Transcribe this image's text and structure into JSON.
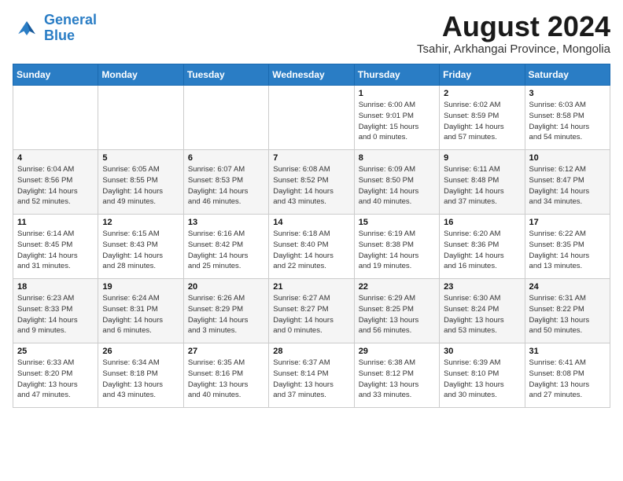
{
  "header": {
    "logo_line1": "General",
    "logo_line2": "Blue",
    "month_year": "August 2024",
    "subtitle": "Tsahir, Arkhangai Province, Mongolia"
  },
  "weekdays": [
    "Sunday",
    "Monday",
    "Tuesday",
    "Wednesday",
    "Thursday",
    "Friday",
    "Saturday"
  ],
  "weeks": [
    [
      {
        "day": "",
        "info": ""
      },
      {
        "day": "",
        "info": ""
      },
      {
        "day": "",
        "info": ""
      },
      {
        "day": "",
        "info": ""
      },
      {
        "day": "1",
        "info": "Sunrise: 6:00 AM\nSunset: 9:01 PM\nDaylight: 15 hours\nand 0 minutes."
      },
      {
        "day": "2",
        "info": "Sunrise: 6:02 AM\nSunset: 8:59 PM\nDaylight: 14 hours\nand 57 minutes."
      },
      {
        "day": "3",
        "info": "Sunrise: 6:03 AM\nSunset: 8:58 PM\nDaylight: 14 hours\nand 54 minutes."
      }
    ],
    [
      {
        "day": "4",
        "info": "Sunrise: 6:04 AM\nSunset: 8:56 PM\nDaylight: 14 hours\nand 52 minutes."
      },
      {
        "day": "5",
        "info": "Sunrise: 6:05 AM\nSunset: 8:55 PM\nDaylight: 14 hours\nand 49 minutes."
      },
      {
        "day": "6",
        "info": "Sunrise: 6:07 AM\nSunset: 8:53 PM\nDaylight: 14 hours\nand 46 minutes."
      },
      {
        "day": "7",
        "info": "Sunrise: 6:08 AM\nSunset: 8:52 PM\nDaylight: 14 hours\nand 43 minutes."
      },
      {
        "day": "8",
        "info": "Sunrise: 6:09 AM\nSunset: 8:50 PM\nDaylight: 14 hours\nand 40 minutes."
      },
      {
        "day": "9",
        "info": "Sunrise: 6:11 AM\nSunset: 8:48 PM\nDaylight: 14 hours\nand 37 minutes."
      },
      {
        "day": "10",
        "info": "Sunrise: 6:12 AM\nSunset: 8:47 PM\nDaylight: 14 hours\nand 34 minutes."
      }
    ],
    [
      {
        "day": "11",
        "info": "Sunrise: 6:14 AM\nSunset: 8:45 PM\nDaylight: 14 hours\nand 31 minutes."
      },
      {
        "day": "12",
        "info": "Sunrise: 6:15 AM\nSunset: 8:43 PM\nDaylight: 14 hours\nand 28 minutes."
      },
      {
        "day": "13",
        "info": "Sunrise: 6:16 AM\nSunset: 8:42 PM\nDaylight: 14 hours\nand 25 minutes."
      },
      {
        "day": "14",
        "info": "Sunrise: 6:18 AM\nSunset: 8:40 PM\nDaylight: 14 hours\nand 22 minutes."
      },
      {
        "day": "15",
        "info": "Sunrise: 6:19 AM\nSunset: 8:38 PM\nDaylight: 14 hours\nand 19 minutes."
      },
      {
        "day": "16",
        "info": "Sunrise: 6:20 AM\nSunset: 8:36 PM\nDaylight: 14 hours\nand 16 minutes."
      },
      {
        "day": "17",
        "info": "Sunrise: 6:22 AM\nSunset: 8:35 PM\nDaylight: 14 hours\nand 13 minutes."
      }
    ],
    [
      {
        "day": "18",
        "info": "Sunrise: 6:23 AM\nSunset: 8:33 PM\nDaylight: 14 hours\nand 9 minutes."
      },
      {
        "day": "19",
        "info": "Sunrise: 6:24 AM\nSunset: 8:31 PM\nDaylight: 14 hours\nand 6 minutes."
      },
      {
        "day": "20",
        "info": "Sunrise: 6:26 AM\nSunset: 8:29 PM\nDaylight: 14 hours\nand 3 minutes."
      },
      {
        "day": "21",
        "info": "Sunrise: 6:27 AM\nSunset: 8:27 PM\nDaylight: 14 hours\nand 0 minutes."
      },
      {
        "day": "22",
        "info": "Sunrise: 6:29 AM\nSunset: 8:25 PM\nDaylight: 13 hours\nand 56 minutes."
      },
      {
        "day": "23",
        "info": "Sunrise: 6:30 AM\nSunset: 8:24 PM\nDaylight: 13 hours\nand 53 minutes."
      },
      {
        "day": "24",
        "info": "Sunrise: 6:31 AM\nSunset: 8:22 PM\nDaylight: 13 hours\nand 50 minutes."
      }
    ],
    [
      {
        "day": "25",
        "info": "Sunrise: 6:33 AM\nSunset: 8:20 PM\nDaylight: 13 hours\nand 47 minutes."
      },
      {
        "day": "26",
        "info": "Sunrise: 6:34 AM\nSunset: 8:18 PM\nDaylight: 13 hours\nand 43 minutes."
      },
      {
        "day": "27",
        "info": "Sunrise: 6:35 AM\nSunset: 8:16 PM\nDaylight: 13 hours\nand 40 minutes."
      },
      {
        "day": "28",
        "info": "Sunrise: 6:37 AM\nSunset: 8:14 PM\nDaylight: 13 hours\nand 37 minutes."
      },
      {
        "day": "29",
        "info": "Sunrise: 6:38 AM\nSunset: 8:12 PM\nDaylight: 13 hours\nand 33 minutes."
      },
      {
        "day": "30",
        "info": "Sunrise: 6:39 AM\nSunset: 8:10 PM\nDaylight: 13 hours\nand 30 minutes."
      },
      {
        "day": "31",
        "info": "Sunrise: 6:41 AM\nSunset: 8:08 PM\nDaylight: 13 hours\nand 27 minutes."
      }
    ]
  ]
}
